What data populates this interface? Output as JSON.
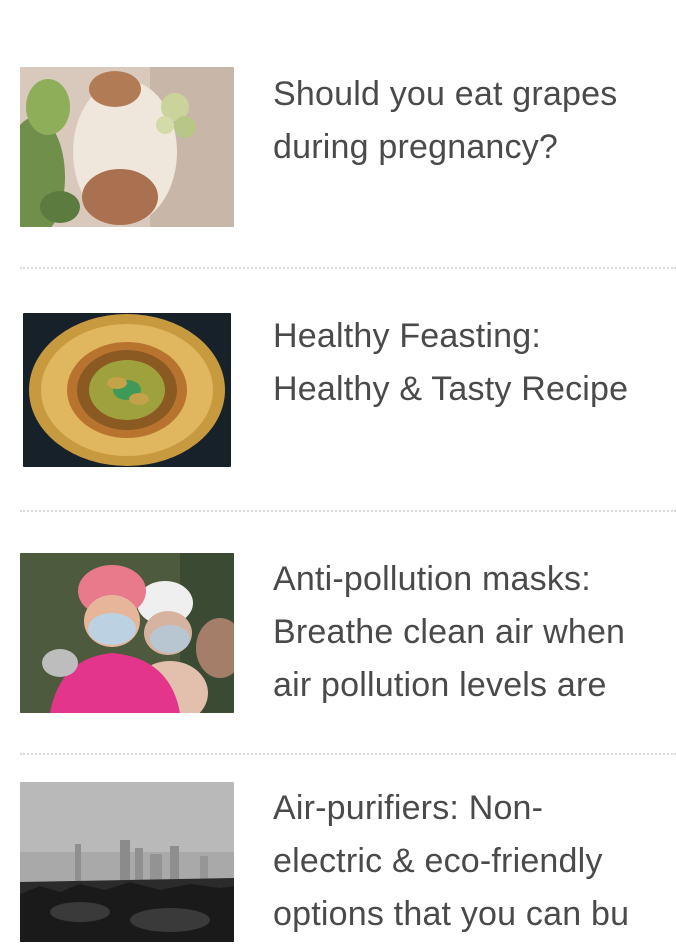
{
  "articles": [
    {
      "title": "Should you eat grapes\nduring pregnancy?",
      "thumbnail_icon": "grapes-basket-photo"
    },
    {
      "title": "Healthy Feasting:\nHealthy & Tasty Recipe",
      "thumbnail_icon": "food-plate-photo"
    },
    {
      "title": "Anti-pollution masks:\nBreathe clean air when\nair pollution levels are",
      "thumbnail_icon": "masked-people-photo"
    },
    {
      "title": "Air-purifiers: Non-\nelectric & eco-friendly\noptions that you can bu",
      "thumbnail_icon": "smoggy-city-photo"
    }
  ]
}
